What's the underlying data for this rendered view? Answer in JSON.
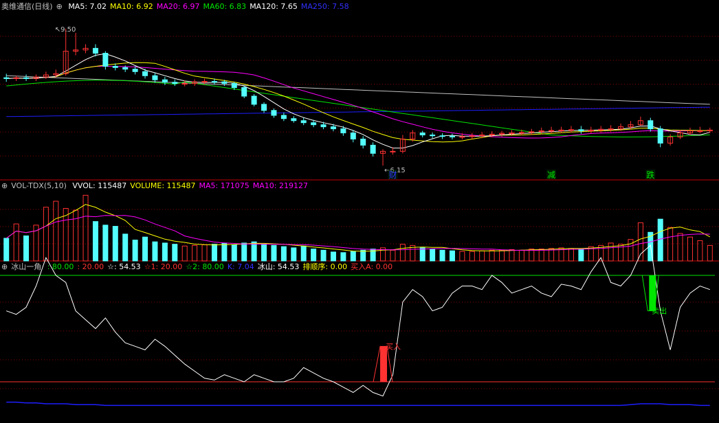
{
  "colors": {
    "background": "#000000",
    "up": "#ff3232",
    "down": "#54ffff",
    "ma5": "#ffffff",
    "ma10": "#ffff00",
    "ma20": "#ff00ff",
    "ma60": "#00e600",
    "ma120": "#c0c0c0",
    "ma250": "#1e1eff",
    "grid": "#8b0000",
    "separator": "#c00000",
    "label": "#c0c0c0"
  },
  "main_legend": {
    "title": "奥维通信(日线)",
    "items": [
      {
        "text": "MA5: 7.02",
        "color": "#ffffff"
      },
      {
        "text": "MA10: 6.92",
        "color": "#ffff00"
      },
      {
        "text": "MA20: 6.97",
        "color": "#ff00ff"
      },
      {
        "text": "MA60: 6.83",
        "color": "#00e600"
      },
      {
        "text": "MA120: 7.65",
        "color": "#ffffff"
      },
      {
        "text": "MA250: 7.58",
        "color": "#3030ff"
      }
    ]
  },
  "vol_legend": {
    "title": "VOL-TDX(5,10)",
    "items": [
      {
        "text": "VVOL: 115487",
        "color": "#ffffff"
      },
      {
        "text": "VOLUME: 115487",
        "color": "#ffff00"
      },
      {
        "text": "MA5: 171075",
        "color": "#ff00ff"
      },
      {
        "text": "MA10: 219127",
        "color": "#ff00ff"
      }
    ]
  },
  "ind_legend": {
    "title": "冰山一角",
    "items": [
      {
        "text": ": 80.00",
        "color": "#00e600"
      },
      {
        "text": ": 20.00",
        "color": "#ff3232"
      },
      {
        "text": "☆: 54.53",
        "color": "#ffffff"
      },
      {
        "text": "☆1: 20.00",
        "color": "#ff3232"
      },
      {
        "text": "☆2: 80.00",
        "color": "#00e600"
      },
      {
        "text": "K: 7.04",
        "color": "#3030ff"
      },
      {
        "text": "冰山: 54.53",
        "color": "#ffffff"
      },
      {
        "text": "排顺序: 0.00",
        "color": "#ffff00"
      },
      {
        "text": "买入A: 0.00",
        "color": "#ff3232"
      }
    ]
  },
  "annotations": {
    "high_price": "9.50",
    "low_price": "6.15",
    "marker_cai": "财",
    "marker_jian": "减",
    "marker_die": "跌",
    "buy_label": "买入",
    "sell_label": "卖出"
  },
  "chart_data": {
    "type": "candlestick",
    "n_bars": 72,
    "price_range": [
      5.8,
      9.9
    ],
    "candles": {
      "open": [
        8.3,
        8.28,
        8.3,
        8.28,
        8.32,
        8.37,
        8.4,
        8.95,
        8.98,
        9.02,
        8.9,
        8.58,
        8.55,
        8.51,
        8.45,
        8.35,
        8.25,
        8.19,
        8.16,
        8.16,
        8.2,
        8.21,
        8.2,
        8.16,
        8.06,
        7.85,
        7.65,
        7.5,
        7.38,
        7.3,
        7.25,
        7.2,
        7.15,
        7.1,
        7.05,
        6.95,
        6.8,
        6.65,
        6.45,
        6.5,
        6.5,
        6.8,
        6.95,
        6.9,
        6.88,
        6.87,
        6.85,
        6.86,
        6.88,
        6.9,
        6.92,
        6.94,
        6.95,
        6.96,
        6.98,
        7.0,
        7.01,
        7.02,
        7.03,
        7.0,
        7.02,
        7.04,
        7.05,
        7.1,
        7.15,
        7.25,
        7.05,
        6.7,
        6.85,
        6.95,
        7.0,
        7.0
      ],
      "close": [
        8.28,
        8.3,
        8.28,
        8.32,
        8.37,
        8.4,
        8.95,
        8.98,
        9.02,
        8.9,
        8.58,
        8.55,
        8.51,
        8.45,
        8.35,
        8.25,
        8.19,
        8.16,
        8.16,
        8.2,
        8.21,
        8.2,
        8.16,
        8.06,
        7.85,
        7.65,
        7.5,
        7.38,
        7.3,
        7.25,
        7.2,
        7.15,
        7.1,
        7.05,
        6.95,
        6.8,
        6.65,
        6.45,
        6.5,
        6.5,
        6.8,
        6.95,
        6.9,
        6.88,
        6.87,
        6.85,
        6.86,
        6.88,
        6.9,
        6.92,
        6.94,
        6.95,
        6.96,
        6.98,
        7.0,
        7.01,
        7.02,
        7.03,
        7.0,
        7.02,
        7.04,
        7.05,
        7.1,
        7.15,
        7.25,
        7.05,
        6.7,
        6.85,
        6.95,
        7.0,
        7.0,
        7.02
      ],
      "high": [
        8.4,
        8.35,
        8.38,
        8.38,
        8.45,
        8.5,
        9.5,
        9.4,
        9.12,
        9.12,
        8.95,
        8.65,
        8.6,
        8.58,
        8.52,
        8.42,
        8.32,
        8.26,
        8.23,
        8.26,
        8.28,
        8.28,
        8.25,
        8.2,
        8.1,
        7.9,
        7.7,
        7.55,
        7.45,
        7.36,
        7.32,
        7.27,
        7.22,
        7.17,
        7.12,
        7.02,
        6.87,
        6.72,
        6.55,
        6.6,
        6.9,
        7.02,
        7.0,
        6.96,
        6.94,
        6.93,
        6.94,
        6.95,
        6.97,
        6.99,
        7.0,
        7.02,
        7.03,
        7.05,
        7.08,
        7.1,
        7.1,
        7.12,
        7.12,
        7.1,
        7.12,
        7.14,
        7.18,
        7.24,
        7.35,
        7.32,
        7.12,
        6.92,
        7.02,
        7.08,
        7.1,
        7.08
      ],
      "low": [
        8.2,
        8.22,
        8.22,
        8.22,
        8.27,
        8.31,
        8.35,
        8.85,
        8.9,
        8.82,
        8.5,
        8.48,
        8.44,
        8.38,
        8.28,
        8.18,
        8.12,
        8.1,
        8.09,
        8.1,
        8.14,
        8.13,
        8.1,
        8.0,
        7.8,
        7.6,
        7.44,
        7.32,
        7.24,
        7.2,
        7.14,
        7.09,
        7.04,
        6.99,
        6.88,
        6.72,
        6.57,
        6.37,
        6.15,
        6.42,
        6.45,
        6.74,
        6.84,
        6.82,
        6.8,
        6.79,
        6.79,
        6.8,
        6.82,
        6.84,
        6.86,
        6.88,
        6.89,
        6.9,
        6.92,
        6.94,
        6.95,
        6.96,
        6.93,
        6.94,
        6.96,
        6.98,
        7.0,
        7.04,
        7.12,
        6.98,
        6.6,
        6.64,
        6.8,
        6.9,
        6.94,
        6.95
      ]
    },
    "volume": [
      38,
      62,
      42,
      60,
      90,
      100,
      88,
      85,
      110,
      66,
      60,
      58,
      45,
      35,
      40,
      32,
      30,
      28,
      25,
      26,
      27,
      28,
      30,
      27,
      30,
      32,
      28,
      26,
      24,
      22,
      25,
      20,
      18,
      15,
      14,
      16,
      18,
      20,
      22,
      18,
      28,
      26,
      22,
      20,
      18,
      17,
      16,
      16,
      17,
      18,
      18,
      19,
      18,
      20,
      20,
      21,
      22,
      21,
      20,
      24,
      26,
      30,
      28,
      36,
      64,
      48,
      70,
      56,
      46,
      40,
      34,
      26
    ],
    "iceberg": [
      60,
      58,
      62,
      74,
      90,
      80,
      76,
      60,
      55,
      50,
      56,
      48,
      42,
      40,
      38,
      44,
      40,
      35,
      30,
      26,
      22,
      21,
      24,
      22,
      20,
      24,
      22,
      20,
      20,
      22,
      28,
      25,
      22,
      20,
      17,
      14,
      18,
      14,
      12,
      24,
      65,
      72,
      68,
      60,
      62,
      70,
      74,
      74,
      72,
      80,
      76,
      70,
      72,
      74,
      70,
      68,
      75,
      74,
      72,
      82,
      90,
      76,
      74,
      80,
      92,
      97,
      60,
      38,
      62,
      70,
      74,
      72
    ],
    "iceberg_levels": {
      "upper": 80,
      "lower": 20
    },
    "k_line": [
      12,
      12,
      11,
      11,
      10,
      10,
      10,
      9,
      9,
      9,
      8,
      8,
      8,
      8,
      8,
      8,
      8,
      8,
      8,
      8,
      8,
      8,
      8,
      8,
      8,
      8,
      8,
      8,
      8,
      8,
      8,
      8,
      8,
      8,
      8,
      8,
      8,
      8,
      8,
      8,
      8,
      8,
      8,
      8,
      8,
      8,
      8,
      8,
      8,
      8,
      8,
      8,
      8,
      8,
      8,
      8,
      8,
      8,
      8,
      8,
      8,
      8,
      8,
      9,
      10,
      10,
      10,
      9,
      9,
      9,
      8,
      8
    ]
  }
}
